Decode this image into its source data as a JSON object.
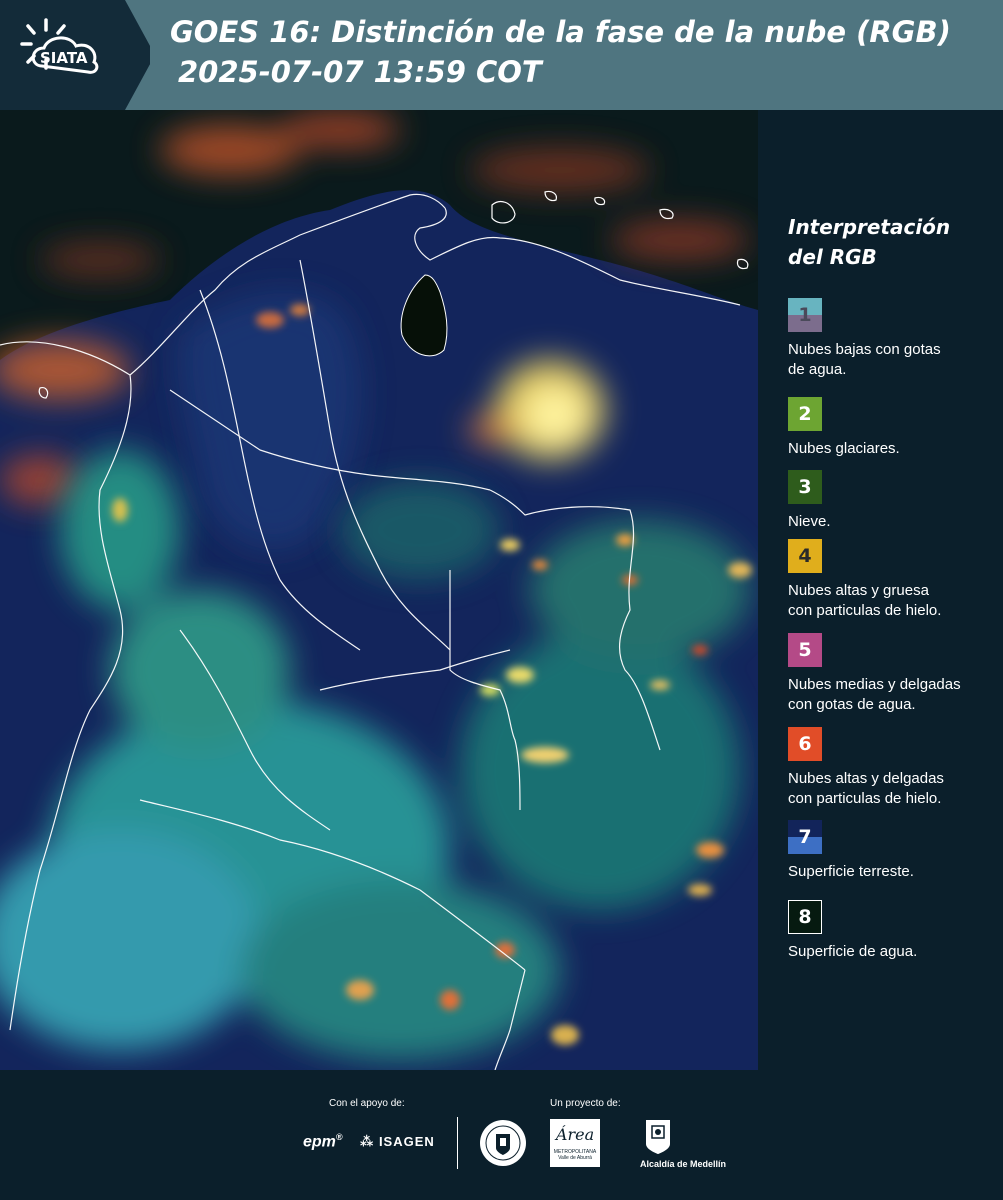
{
  "header": {
    "logo_text": "SIATA",
    "title": "GOES 16: Distinción de la fase de la nube (RGB)",
    "subtitle": "2025-07-07 13:59 COT",
    "background_color": "#4f7580"
  },
  "map": {
    "content": "satellite-rgb-cloud-phase-imagery",
    "background_color": "#0c1930"
  },
  "legend": {
    "title_line1": "Interpretación",
    "title_line2": "del RGB",
    "items": [
      {
        "number": "1",
        "label_line1": "Nubes bajas con gotas",
        "label_line2": "de agua.",
        "color_top": "#68b4c0",
        "color_bottom": "#7c6d8d"
      },
      {
        "number": "2",
        "label_line1": "Nubes glaciares.",
        "label_line2": "",
        "color_top": "#6da532",
        "color_bottom": "#6da532"
      },
      {
        "number": "3",
        "label_line1": "Nieve.",
        "label_line2": "",
        "color_top": "#2e5c1c",
        "color_bottom": "#2e5c1c"
      },
      {
        "number": "4",
        "label_line1": "Nubes altas y gruesa",
        "label_line2": "con particulas de hielo.",
        "color_top": "#e0ae1c",
        "color_bottom": "#e0ae1c"
      },
      {
        "number": "5",
        "label_line1": "Nubes medias y delgadas",
        "label_line2": "con gotas de agua.",
        "color_top": "#b44a87",
        "color_bottom": "#b44a87"
      },
      {
        "number": "6",
        "label_line1": "Nubes altas y delgadas",
        "label_line2": "con particulas de hielo.",
        "color_top": "#e14d28",
        "color_bottom": "#e14d28"
      },
      {
        "number": "7",
        "label_line1": "Superficie terreste.",
        "label_line2": "",
        "color_top": "#12245a",
        "color_bottom": "#3d6fc4"
      },
      {
        "number": "8",
        "label_line1": "Superficie de agua.",
        "label_line2": "",
        "color_top": "#061a10",
        "color_bottom": "#061a10"
      }
    ]
  },
  "footer": {
    "support_label": "Con el apoyo de:",
    "project_label": "Un proyecto de:",
    "sponsor_epm": "epm",
    "sponsor_isagen": "ISAGEN",
    "project_area_line1": "Área",
    "project_area_line2": "METROPOLITANA",
    "project_area_line3": "Valle de Aburrá",
    "project_alcaldia": "Alcaldía de Medellín"
  }
}
